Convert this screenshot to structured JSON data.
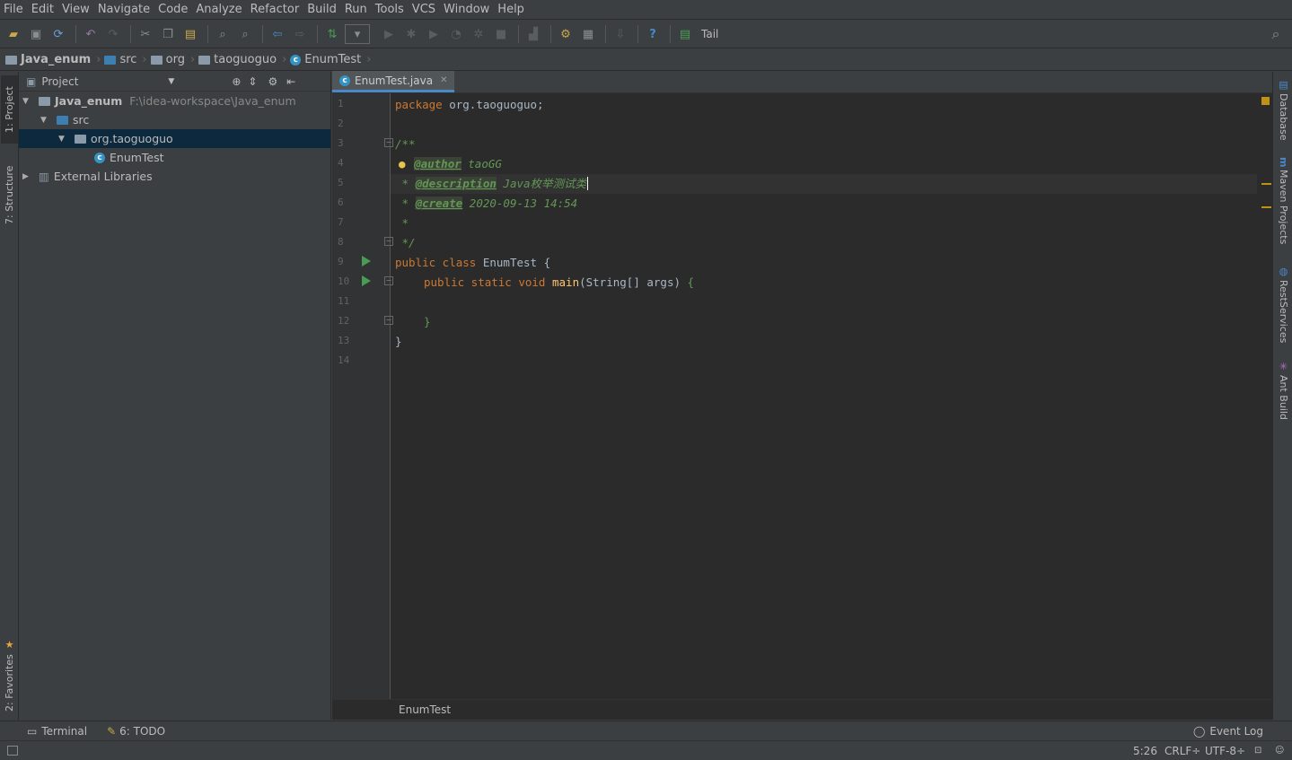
{
  "menu": [
    "File",
    "Edit",
    "View",
    "Navigate",
    "Code",
    "Analyze",
    "Refactor",
    "Build",
    "Run",
    "Tools",
    "VCS",
    "Window",
    "Help"
  ],
  "toolbar": {
    "tail": "Tail"
  },
  "breadcrumb": [
    "Java_enum",
    "src",
    "org",
    "taoguoguo",
    "EnumTest"
  ],
  "left_tabs": {
    "project": "1: Project",
    "structure": "7: Structure",
    "favorites": "2: Favorites"
  },
  "right_tabs": {
    "database": "Database",
    "maven": "Maven Projects",
    "rest": "RestServices",
    "ant": "Ant Build"
  },
  "project": {
    "header": "Project",
    "tree": [
      {
        "label": "Java_enum",
        "path": "F:\\idea-workspace\\Java_enum"
      },
      {
        "label": "src"
      },
      {
        "label": "org.taoguoguo"
      },
      {
        "label": "EnumTest"
      },
      {
        "label": "External Libraries"
      }
    ]
  },
  "editor": {
    "tab": "EnumTest.java",
    "line_numbers": [
      "1",
      "2",
      "3",
      "4",
      "5",
      "6",
      "7",
      "8",
      "9",
      "10",
      "11",
      "12",
      "13",
      "14"
    ],
    "code": {
      "l1_kw": "package",
      "l1_rest": " org.taoguoguo;",
      "l3": "/**",
      "l4_tag": "@author",
      "l4_rest": " taoGG",
      "l5_star": " * ",
      "l5_tag": "@description",
      "l5_rest": " Java枚举测试类",
      "l6_star": " * ",
      "l6_tag": "@create",
      "l6_rest": " 2020-09-13 14:54",
      "l7": " *",
      "l8": " */",
      "l9_kw": "public class ",
      "l9_name": "EnumTest ",
      "l9_brace": "{",
      "l10_kw": "public static void ",
      "l10_fn": "main",
      "l10_rest": "(String[] args) ",
      "l10_brace": "{",
      "l12": "}",
      "l13": "}"
    },
    "crumb": "EnumTest"
  },
  "bottom": {
    "terminal": "Terminal",
    "todo": "6: TODO",
    "event_log": "Event Log"
  },
  "status": {
    "pos": "5:26",
    "crlf": "CRLF÷",
    "enc": "UTF-8÷"
  }
}
